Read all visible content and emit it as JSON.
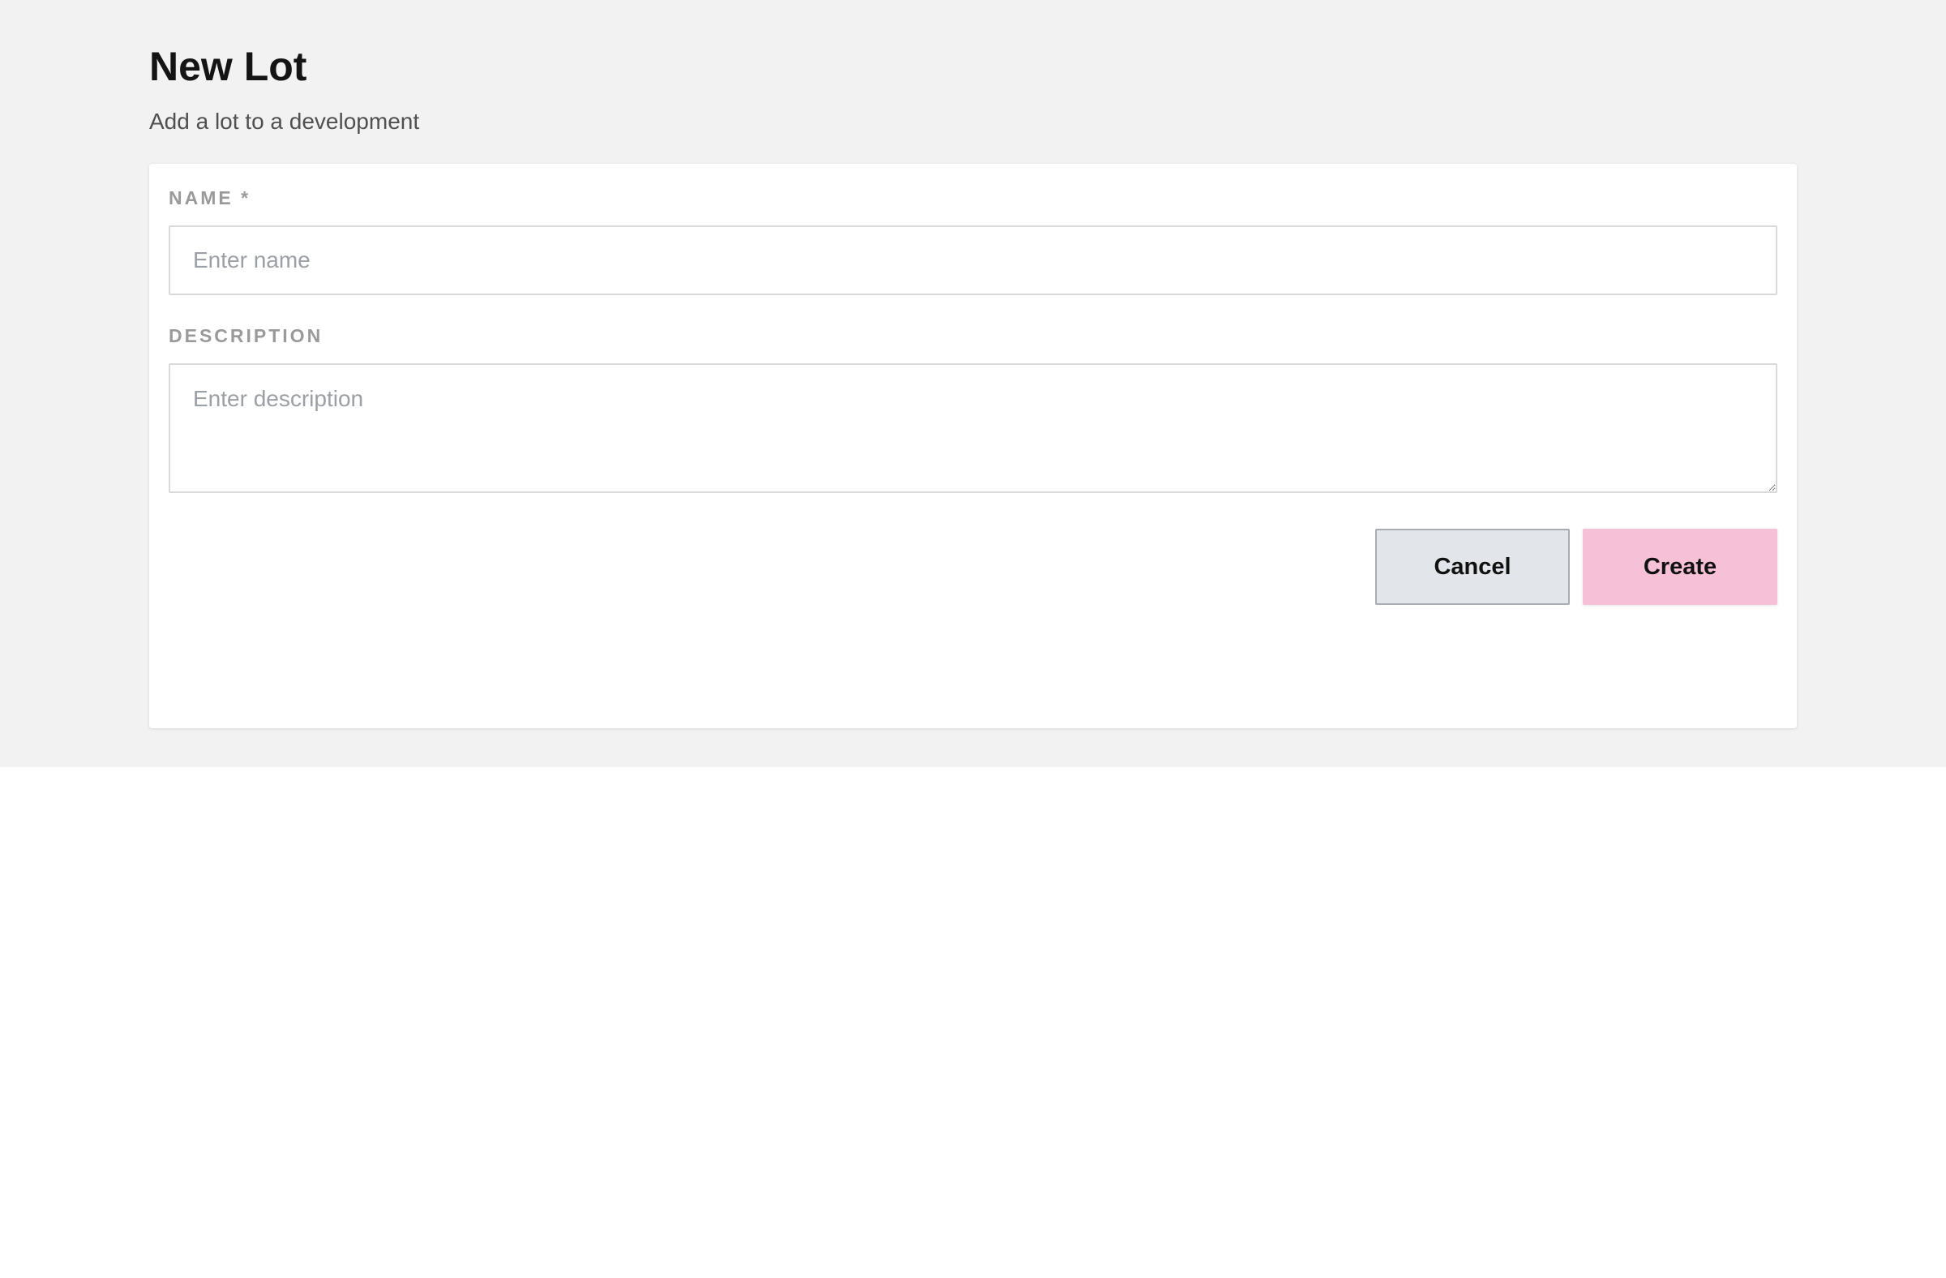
{
  "header": {
    "title": "New Lot",
    "subtitle": "Add a lot to a development"
  },
  "form": {
    "name_label": "NAME *",
    "name_placeholder": "Enter name",
    "name_value": "",
    "description_label": "DESCRIPTION",
    "description_placeholder": "Enter description",
    "description_value": "",
    "cancel_label": "Cancel",
    "create_label": "Create"
  },
  "colors": {
    "page_background": "#f2f2f2",
    "card_background": "#ffffff",
    "cancel_button": "#e2e5ea",
    "create_button": "#f6c1d7"
  }
}
